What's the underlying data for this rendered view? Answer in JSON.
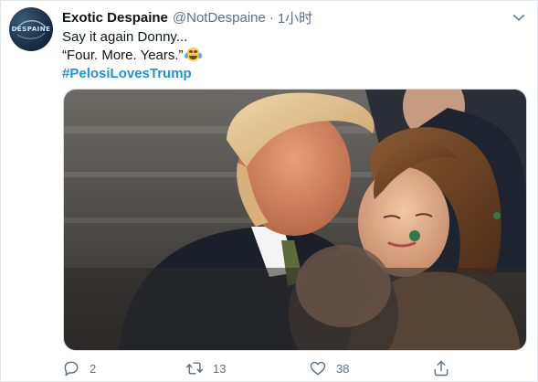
{
  "tweet": {
    "author_name": "Exotic Despaine",
    "handle": "@NotDespaine",
    "separator": "·",
    "time": "1小时",
    "avatar_text": "DESPAINE",
    "text_line1": "Say it again Donny...",
    "text_line2": "“Four. More. Years.”",
    "emoji": "face-with-tears-of-joy",
    "hashtag": "#PelosiLovesTrump"
  },
  "media": {
    "icon": "photo"
  },
  "actions": {
    "reply_count": "2",
    "retweet_count": "13",
    "like_count": "38"
  },
  "colors": {
    "hashtag": "#1b95e0",
    "secondary_text": "#5b7083",
    "border": "#cfd9de"
  }
}
